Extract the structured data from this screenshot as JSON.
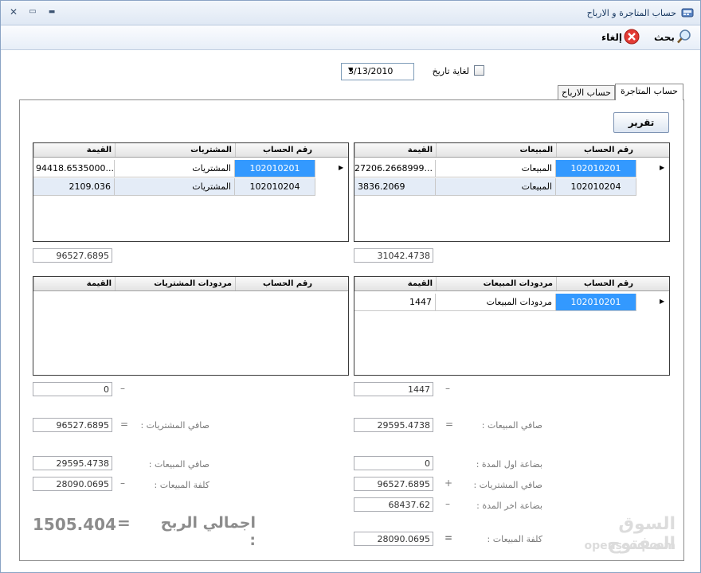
{
  "window": {
    "title": "حساب المتاجرة و الارباح"
  },
  "window_controls": {
    "close": "✕",
    "maximize": "▭",
    "minimize": "▬"
  },
  "toolbar": {
    "search_label": "بحث",
    "cancel_label": "إلغاء"
  },
  "filter": {
    "until_date_label": "لغاية تاريخ",
    "date_value": "3/13/2010",
    "checked": false
  },
  "tabs": {
    "trading": "حساب المتاجرة",
    "profits": "حساب الارباح"
  },
  "report_button": "تقرير",
  "sales_grid": {
    "headers": {
      "account": "رقم الحساب",
      "name": "المبيعات",
      "value": "القيمة"
    },
    "rows": [
      {
        "account": "102010201",
        "name": "المبيعات",
        "value": "27206.2668999..."
      },
      {
        "account": "102010204",
        "name": "المبيعات",
        "value": "3836.2069"
      }
    ],
    "total": "31042.4738"
  },
  "purchases_grid": {
    "headers": {
      "account": "رقم الحساب",
      "name": "المشتريات",
      "value": "القيمة"
    },
    "rows": [
      {
        "account": "102010201",
        "name": "المشتريات",
        "value": "94418.6535000..."
      },
      {
        "account": "102010204",
        "name": "المشتريات",
        "value": "2109.036"
      }
    ],
    "total": "96527.6895"
  },
  "sales_returns_grid": {
    "headers": {
      "account": "رقم الحساب",
      "name": "مردودات المبيعات",
      "value": "القيمة"
    },
    "rows": [
      {
        "account": "102010201",
        "name": "مردودات المبيعات",
        "value": "1447"
      }
    ],
    "total": "1447"
  },
  "purchase_returns_grid": {
    "headers": {
      "account": "رقم الحساب",
      "name": "مردودات المشتريات",
      "value": "القيمة"
    },
    "rows": [],
    "total": "0"
  },
  "summary_right": {
    "net_sales_label": "صافي المبيعات :",
    "net_sales": "29595.4738",
    "opening_stock_label": "بضاعة اول المدة :",
    "opening_stock": "0",
    "net_purchases_label": "صافي المشتريات :",
    "net_purchases": "96527.6895",
    "closing_stock_label": "بضاعة اخر المدة :",
    "closing_stock": "68437.62",
    "cost_of_sales_label": "كلفة المبيعات :",
    "cost_of_sales": "28090.0695"
  },
  "summary_left": {
    "net_purchases_label": "صافي المشتريات :",
    "net_purchases": "96527.6895",
    "net_sales_label": "صافي المبيعات :",
    "net_sales": "29595.4738",
    "cost_of_sales_label": "كلفة المبيعات :",
    "cost_of_sales": "28090.0695"
  },
  "operators": {
    "minus": "–",
    "equals": "=",
    "plus": "+"
  },
  "total_profit": {
    "label": "اجمالي الربح :",
    "equals": "=",
    "value": "1505.404"
  },
  "watermark": {
    "arabic": "السوق المفتوح",
    "latin": "opensooq.com"
  },
  "icons": {
    "app": "calculator-icon",
    "search": "magnifier-icon",
    "cancel": "red-x-circle-icon",
    "row_indicator": "▶",
    "dropdown": "▼"
  },
  "colors": {
    "selection": "#3399ff",
    "alt_row": "#e4ecf7",
    "title_text": "#15365f"
  }
}
